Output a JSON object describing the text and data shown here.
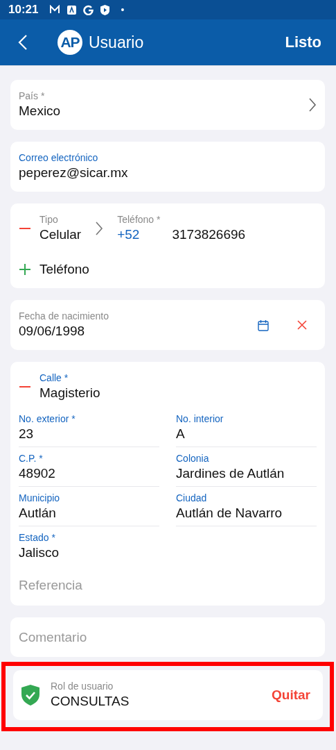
{
  "status_bar": {
    "time": "10:21",
    "dot": "•"
  },
  "app_bar": {
    "avatar": "AP",
    "title": "Usuario",
    "action": "Listo"
  },
  "country": {
    "label": "País *",
    "value": "Mexico",
    "active": false
  },
  "email": {
    "label": "Correo electrónico",
    "value": "peperez@sicar.mx",
    "active": true
  },
  "phones": {
    "items": [
      {
        "type_label": "Tipo",
        "type": "Celular",
        "number_label": "Teléfono *",
        "prefix": "+52",
        "number": "3173826696"
      }
    ],
    "add_label": "Teléfono"
  },
  "birthdate": {
    "label": "Fecha de nacimiento",
    "value": "09/06/1998",
    "active": false
  },
  "address": {
    "street": {
      "label": "Calle *",
      "value": "Magisterio",
      "active": true
    },
    "fields": [
      {
        "label": "No. exterior *",
        "value": "23",
        "active": true
      },
      {
        "label": "No. interior",
        "value": "A",
        "active": true
      },
      {
        "label": "C.P. *",
        "value": "48902",
        "active": true
      },
      {
        "label": "Colonia",
        "value": "Jardines de Autlán",
        "active": true
      },
      {
        "label": "Municipio",
        "value": "Autlán",
        "active": true
      },
      {
        "label": "Ciudad",
        "value": "Autlán de Navarro",
        "active": true
      },
      {
        "label": "Estado *",
        "value": "Jalisco",
        "active": true
      }
    ],
    "reference": {
      "placeholder": "Referencia"
    }
  },
  "comment": {
    "placeholder": "Comentario"
  },
  "role": {
    "label": "Rol de usuario",
    "value": "CONSULTAS",
    "action": "Quitar",
    "highlighted": true
  }
}
